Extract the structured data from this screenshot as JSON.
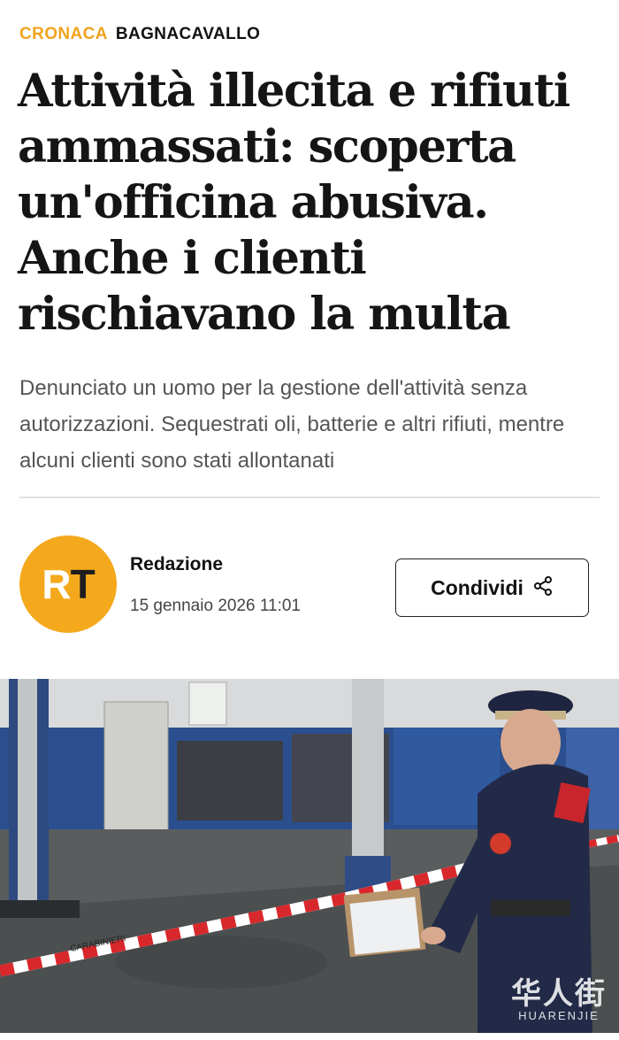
{
  "article": {
    "section": "CRONACA",
    "place": "BAGNACAVALLO",
    "headline": "Attività illecita e rifiuti ammassati: scoperta un'officina abusiva. Anche i clienti rischiavano la multa",
    "summary": "Denunciato un uomo per la gestione dell'attività senza autorizzazioni. Sequestrati oli, batterie e altri rifiuti, mentre alcuni clienti sono stati allontanati"
  },
  "byline": {
    "logo_r": "R",
    "logo_t": "T",
    "author": "Redazione",
    "date": "15 gennaio 2026 11:01"
  },
  "share": {
    "label": "Condividi",
    "icon": "share-icon"
  },
  "photo": {
    "tape_text": "CARABINIERI",
    "watermark_cn": "华人街",
    "watermark_lat": "HUARENJIE"
  },
  "colors": {
    "section": "#f0a31f",
    "logo_bg": "#f4a91d"
  }
}
